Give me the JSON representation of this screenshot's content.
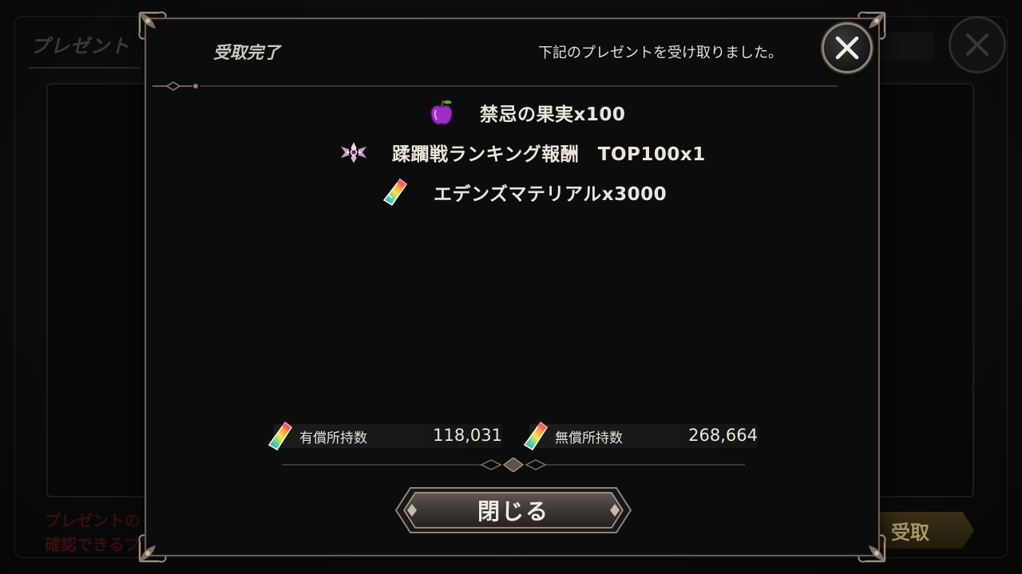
{
  "background": {
    "title": "プレゼント",
    "notice_line1": "プレゼントの",
    "notice_line2": "確認できるプ",
    "receive_button": "受取"
  },
  "modal": {
    "title": "受取完了",
    "message": "下記のプレゼントを受け取りました。",
    "close_icon": "close-icon",
    "rewards": [
      {
        "icon": "apple-icon",
        "label": "禁忌の果実x100"
      },
      {
        "icon": "emblem-icon",
        "label": "蹂躙戦ランキング報酬　TOP100x1"
      },
      {
        "icon": "crystal-icon",
        "label": "エデンズマテリアルx3000"
      }
    ],
    "balances": [
      {
        "icon": "crystal-icon",
        "label": "有償所持数",
        "value": "118,031"
      },
      {
        "icon": "crystal-icon",
        "label": "無償所持数",
        "value": "268,664"
      }
    ],
    "close_button": "閉じる"
  },
  "colors": {
    "frame": "#6a5d52",
    "text": "#ece6da",
    "notice_red": "#3a0e10",
    "receive_gold": "#a89868"
  }
}
